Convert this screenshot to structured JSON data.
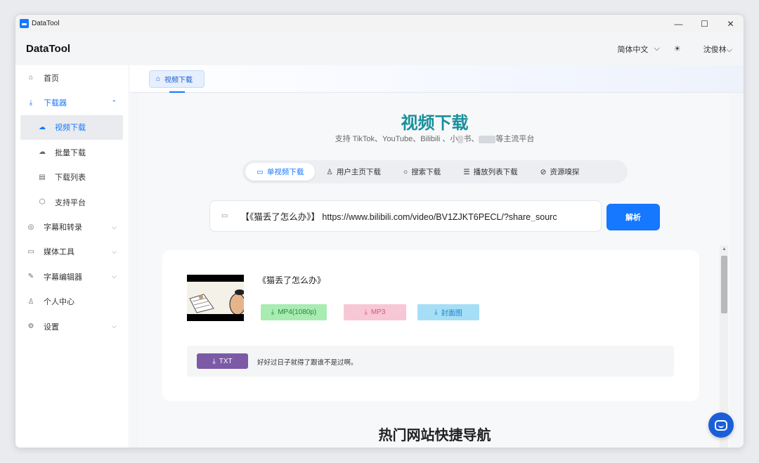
{
  "window": {
    "title": "DataTool",
    "controls": [
      "—",
      "☐",
      "✕"
    ]
  },
  "header": {
    "brand": "DataTool",
    "language": "简体中文",
    "language_caret": "⌵",
    "theme_icon": "☀",
    "user": "沈俊林⌵"
  },
  "sidebar": {
    "items": [
      {
        "icon": "⌂",
        "label": "首页"
      },
      {
        "icon": "⤓",
        "label": "下载器",
        "chevron": "⌃"
      },
      {
        "icon": "☁",
        "label": "视频下载"
      },
      {
        "icon": "☁",
        "label": "批量下载"
      },
      {
        "icon": "▤",
        "label": "下载列表"
      },
      {
        "icon": "⬡",
        "label": "支持平台"
      },
      {
        "icon": "◎",
        "label": "字幕和转录",
        "chevron": "⌵"
      },
      {
        "icon": "▭",
        "label": "媒体工具",
        "chevron": "⌵"
      },
      {
        "icon": "✎",
        "label": "字幕编辑器",
        "chevron": "⌵"
      },
      {
        "icon": "♙",
        "label": "个人中心"
      },
      {
        "icon": "⚙",
        "label": "设置",
        "chevron": "⌵"
      }
    ]
  },
  "page_tab": {
    "icon": "⌂",
    "label": "视频下载"
  },
  "hero": {
    "title": "视频下载",
    "subtitle_a": "支持 TikTok、YouTube、Bilibili 、小",
    "subtitle_b": "书、",
    "subtitle_c": "等主流平台"
  },
  "mode_tabs": [
    {
      "icon": "▭",
      "label": "单视频下载"
    },
    {
      "icon": "♙",
      "label": "用户主页下载"
    },
    {
      "icon": "○",
      "label": "搜索下载"
    },
    {
      "icon": "☰",
      "label": "播放列表下载"
    },
    {
      "icon": "⊘",
      "label": "资源嗅探"
    }
  ],
  "url_input": {
    "icon": "▭",
    "value": "【《猫丢了怎么办》】 https://www.bilibili.com/video/BV1ZJKT6PECL/?share_sourc"
  },
  "parse_button": "解析",
  "result": {
    "title": "《猫丢了怎么办》",
    "download_icon": "⤓",
    "mp4": "MP4(1080p)",
    "mp3": "MP3",
    "cover": "封面图",
    "txt": "TXT",
    "transcript": "好好过日子就得了跟谁不是过啊。"
  },
  "section_heading": "热门网站快捷导航",
  "scroll_up": "▲"
}
